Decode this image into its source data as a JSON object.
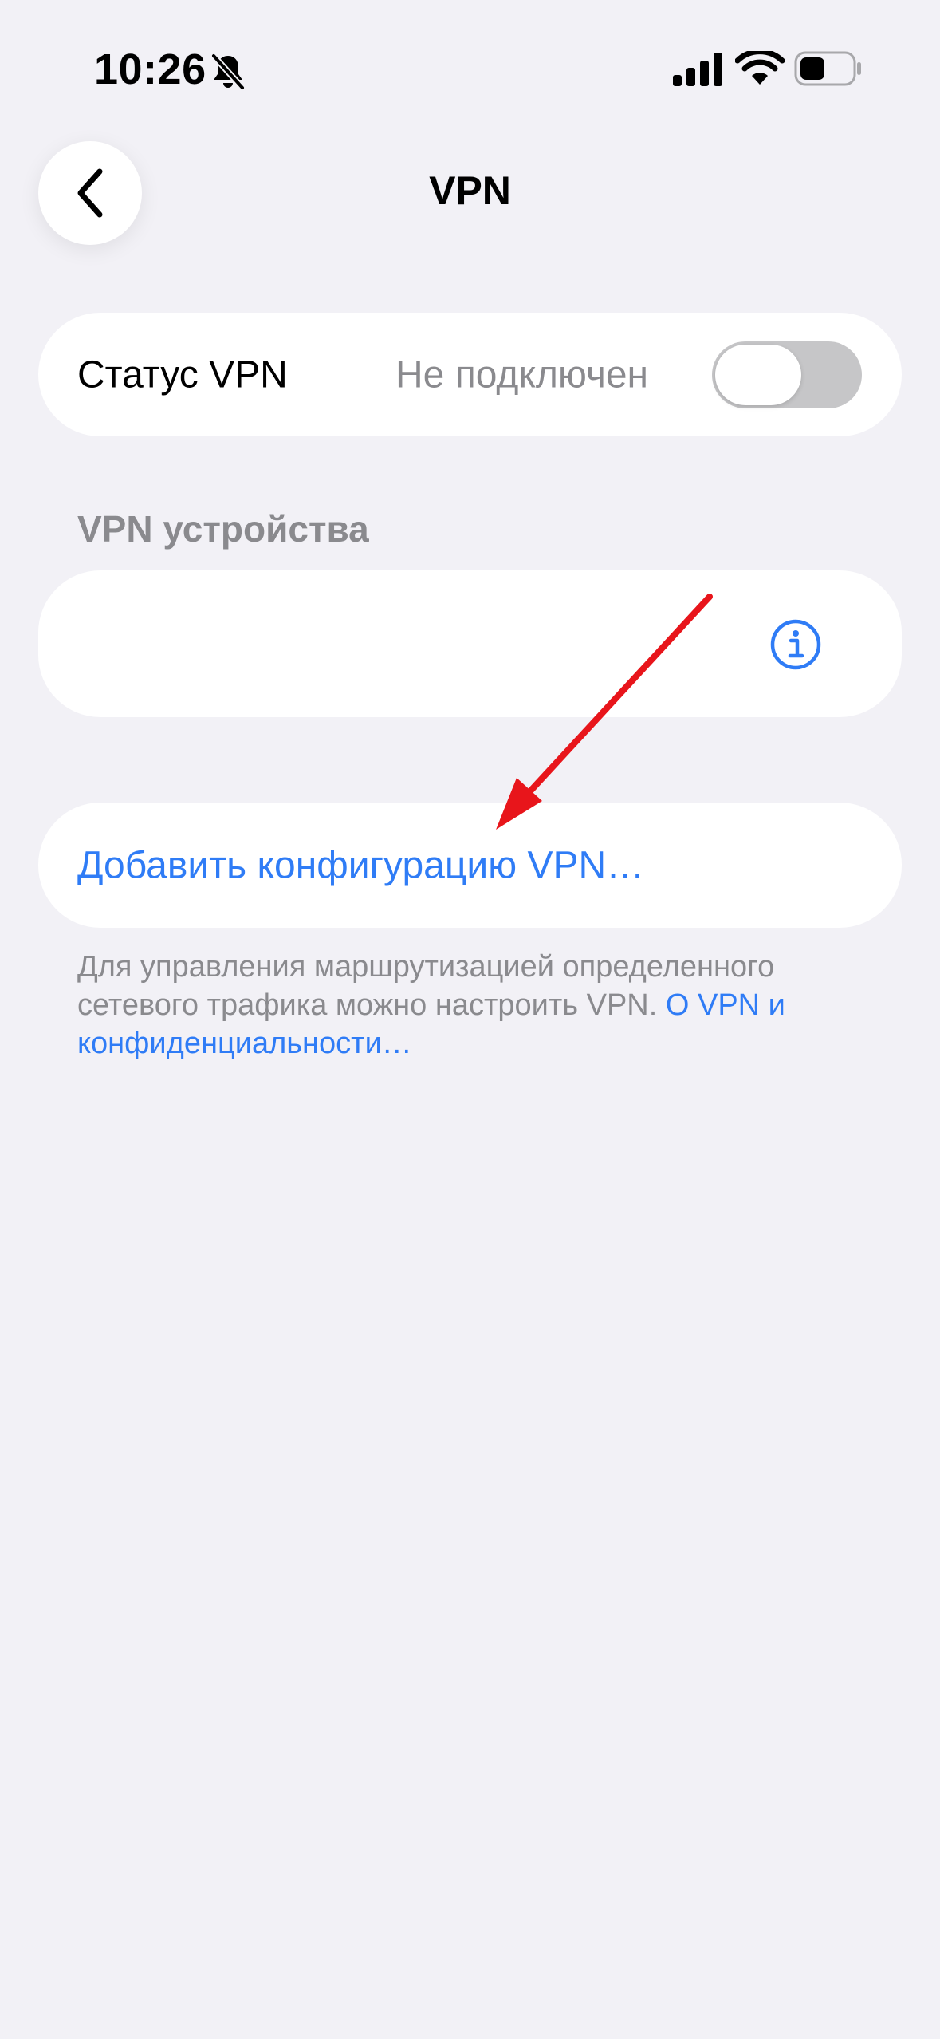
{
  "status_bar": {
    "time": "10:26",
    "icons": [
      "bell-slash-icon",
      "cellular-signal-icon",
      "wifi-icon",
      "battery-icon"
    ]
  },
  "nav": {
    "title": "VPN",
    "back_icon": "chevron-left-icon"
  },
  "vpn_status": {
    "label": "Статус VPN",
    "value": "Не подключен",
    "toggle_on": false
  },
  "devices_section": {
    "header": "VPN устройства",
    "info_icon": "info-circle-icon"
  },
  "add_config": {
    "label": "Добавить конфигурацию VPN…"
  },
  "footer": {
    "text": "Для управления маршрутизацией определенного сетевого трафика можно настроить VPN. ",
    "link": "О VPN и конфиденциальности…"
  },
  "annotation": {
    "type": "red-arrow",
    "color": "#e8151b"
  },
  "colors": {
    "background": "#f2f1f6",
    "card": "#ffffff",
    "accent": "#2f7cf6",
    "secondary_text": "#8a8a8e",
    "toggle_off": "#c6c6c8"
  }
}
